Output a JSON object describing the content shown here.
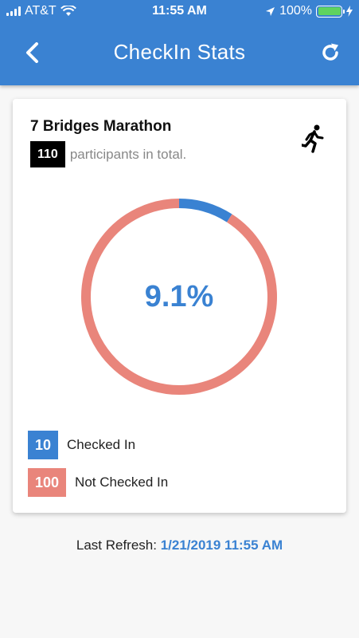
{
  "status_bar": {
    "carrier": "AT&T",
    "time": "11:55 AM",
    "battery": "100%"
  },
  "nav": {
    "title": "CheckIn Stats",
    "back_icon": "chevron-left-icon",
    "refresh_icon": "refresh-icon"
  },
  "event": {
    "name": "7 Bridges Marathon",
    "total": "110",
    "total_text": "participants in total.",
    "icon": "runner-icon"
  },
  "chart_data": {
    "type": "pie",
    "categories": [
      "Checked In",
      "Not Checked In"
    ],
    "values": [
      10,
      100
    ],
    "colors": [
      "#3a82d2",
      "#e9857b"
    ],
    "center_label": "9.1%"
  },
  "legend": [
    {
      "value": "10",
      "label": "Checked In",
      "color": "#3a82d2"
    },
    {
      "value": "100",
      "label": "Not Checked In",
      "color": "#e9857b"
    }
  ],
  "footer": {
    "label": "Last Refresh:",
    "timestamp": "1/21/2019 11:55 AM"
  },
  "colors": {
    "brand": "#3a82d2",
    "checked": "#3a82d2",
    "not_checked": "#e9857b"
  }
}
